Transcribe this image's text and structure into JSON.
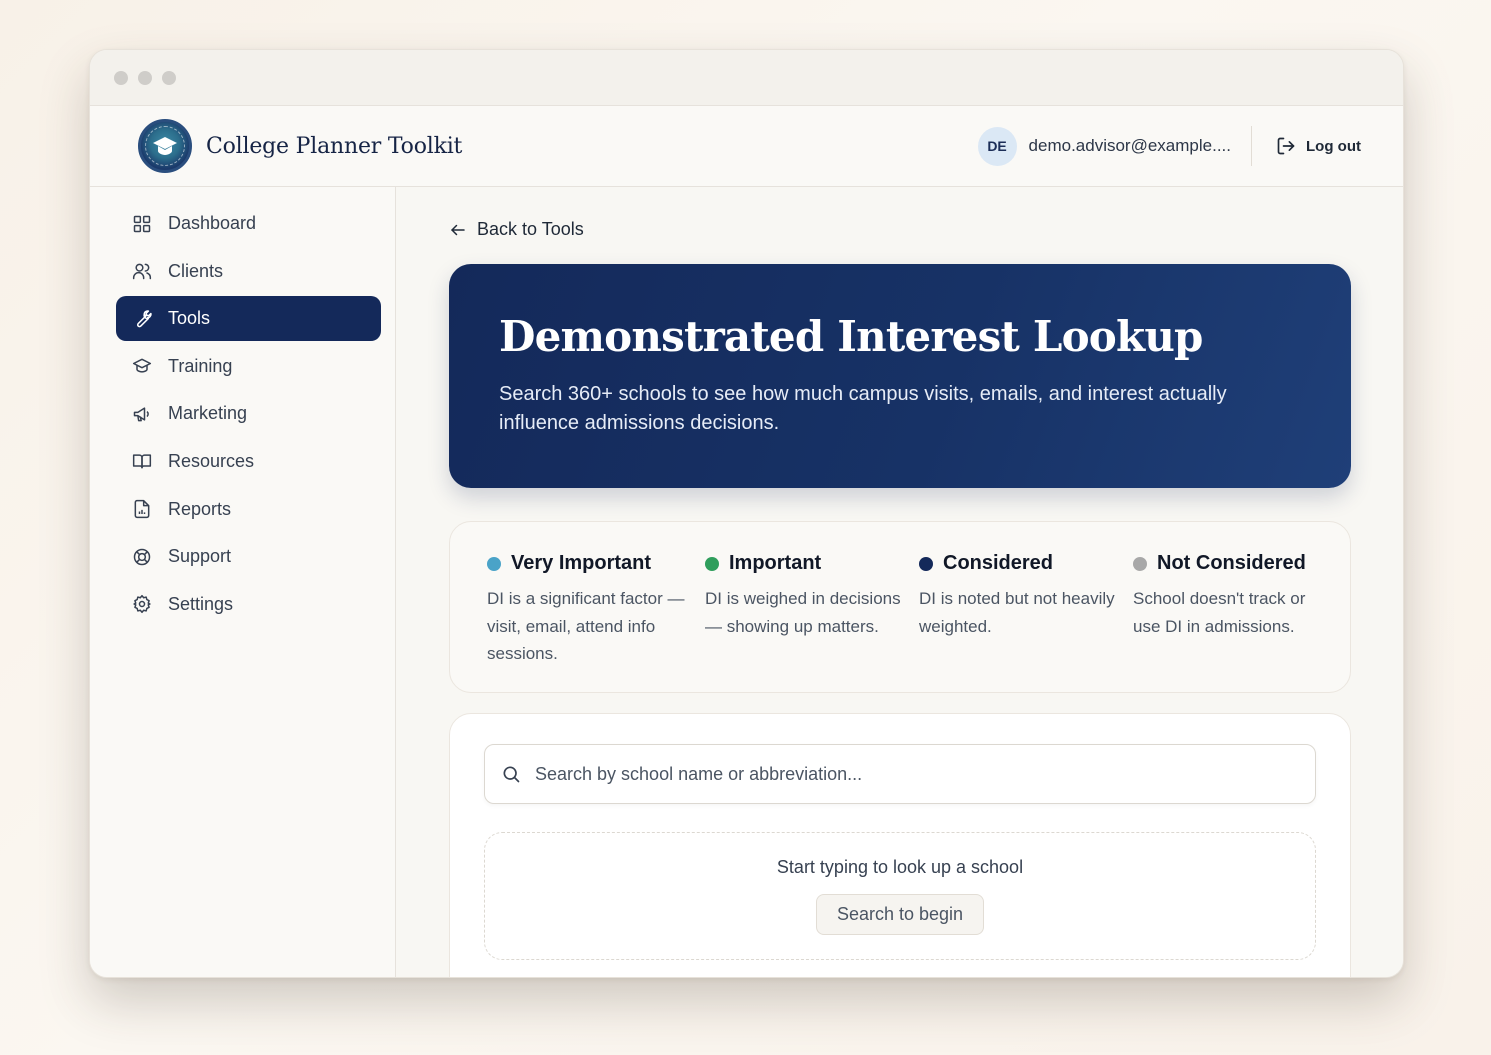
{
  "app": {
    "brand": "College Planner Toolkit",
    "logo_icon": "graduation-cap-icon"
  },
  "user": {
    "initials": "DE",
    "email": "demo.advisor@example....",
    "logout_label": "Log out"
  },
  "sidebar": {
    "items": [
      {
        "label": "Dashboard",
        "icon": "grid-icon",
        "active": false
      },
      {
        "label": "Clients",
        "icon": "users-icon",
        "active": false
      },
      {
        "label": "Tools",
        "icon": "wrench-icon",
        "active": true
      },
      {
        "label": "Training",
        "icon": "graduation-cap-icon",
        "active": false
      },
      {
        "label": "Marketing",
        "icon": "megaphone-icon",
        "active": false
      },
      {
        "label": "Resources",
        "icon": "book-open-icon",
        "active": false
      },
      {
        "label": "Reports",
        "icon": "file-chart-icon",
        "active": false
      },
      {
        "label": "Support",
        "icon": "life-buoy-icon",
        "active": false
      },
      {
        "label": "Settings",
        "icon": "gear-icon",
        "active": false
      }
    ]
  },
  "main": {
    "back_label": "Back to Tools",
    "hero": {
      "title": "Demonstrated Interest Lookup",
      "subtitle": "Search 360+ schools to see how much campus visits, emails, and interest actually influence admissions decisions."
    },
    "legend": [
      {
        "label": "Very Important",
        "color": "#4aa3c8",
        "description": "DI is a significant factor — visit, email, attend info sessions."
      },
      {
        "label": "Important",
        "color": "#2f9e5c",
        "description": "DI is weighed in decisions — showing up matters."
      },
      {
        "label": "Considered",
        "color": "#14295a",
        "description": "DI is noted but not heavily weighted."
      },
      {
        "label": "Not Considered",
        "color": "#a8a8a8",
        "description": "School doesn't track or use DI in admissions."
      }
    ],
    "search": {
      "placeholder": "Search by school name or abbreviation...",
      "empty_title": "Start typing to look up a school",
      "empty_button": "Search to begin"
    }
  }
}
